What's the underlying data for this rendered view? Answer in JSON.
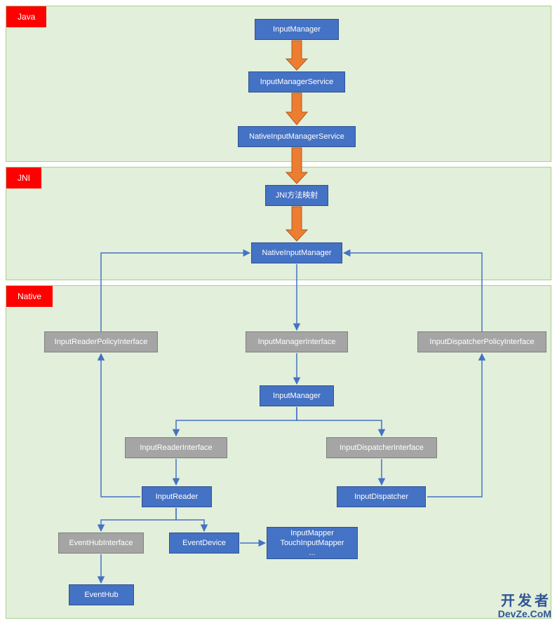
{
  "sections": {
    "java": {
      "label": "Java"
    },
    "jni": {
      "label": "JNI"
    },
    "native": {
      "label": "Native"
    }
  },
  "boxes": {
    "input_manager_top": "InputManager",
    "input_manager_service": "InputManagerService",
    "native_input_manager_service": "NativeInputManagerService",
    "jni_method_map": "JNI方法映射",
    "native_input_manager": "NativeInputManager",
    "input_reader_policy_interface": "InputReaderPolicyInterface",
    "input_manager_interface": "InputManagerInterface",
    "input_dispatcher_policy_interface": "InputDispatcherPolicyInterface",
    "input_manager": "InputManager",
    "input_reader_interface": "InputReaderInterface",
    "input_dispatcher_interface": "InputDispatcherInterface",
    "input_reader": "InputReader",
    "input_dispatcher": "InputDispatcher",
    "event_hub_interface": "EventHubInterface",
    "event_device": "EventDevice",
    "input_mapper": "InputMapper\nTouchInputMapper\n...",
    "event_hub": "EventHub"
  },
  "watermark": {
    "cn": "开发者",
    "en": "DevZe.CoM"
  },
  "chart_data": {
    "type": "diagram",
    "title": "",
    "layers": [
      {
        "name": "Java",
        "nodes": [
          "InputManager",
          "InputManagerService",
          "NativeInputManagerService"
        ]
      },
      {
        "name": "JNI",
        "nodes": [
          "JNI方法映射",
          "NativeInputManager"
        ]
      },
      {
        "name": "Native",
        "nodes": [
          "InputReaderPolicyInterface",
          "InputManagerInterface",
          "InputDispatcherPolicyInterface",
          "InputManager",
          "InputReaderInterface",
          "InputDispatcherInterface",
          "InputReader",
          "InputDispatcher",
          "EventHubInterface",
          "EventDevice",
          "InputMapper/TouchInputMapper/...",
          "EventHub"
        ]
      }
    ],
    "edges": [
      {
        "from": "InputManager(Java)",
        "to": "InputManagerService",
        "style": "thick-orange"
      },
      {
        "from": "InputManagerService",
        "to": "NativeInputManagerService",
        "style": "thick-orange"
      },
      {
        "from": "NativeInputManagerService",
        "to": "JNI方法映射",
        "style": "thick-orange"
      },
      {
        "from": "JNI方法映射",
        "to": "NativeInputManager",
        "style": "thick-orange"
      },
      {
        "from": "NativeInputManager",
        "to": "InputReaderPolicyInterface",
        "style": "blue-arrow",
        "reverse": true
      },
      {
        "from": "NativeInputManager",
        "to": "InputDispatcherPolicyInterface",
        "style": "blue-arrow",
        "reverse": true
      },
      {
        "from": "NativeInputManager",
        "to": "InputManagerInterface",
        "style": "blue-arrow"
      },
      {
        "from": "InputManagerInterface",
        "to": "InputManager(Native)",
        "style": "blue-arrow"
      },
      {
        "from": "InputManager(Native)",
        "to": "InputReaderInterface",
        "style": "blue-arrow"
      },
      {
        "from": "InputManager(Native)",
        "to": "InputDispatcherInterface",
        "style": "blue-arrow"
      },
      {
        "from": "InputReaderInterface",
        "to": "InputReader",
        "style": "blue-arrow"
      },
      {
        "from": "InputDispatcherInterface",
        "to": "InputDispatcher",
        "style": "blue-arrow"
      },
      {
        "from": "InputReader",
        "to": "InputReaderPolicyInterface",
        "style": "blue-arrow"
      },
      {
        "from": "InputDispatcher",
        "to": "InputDispatcherPolicyInterface",
        "style": "blue-arrow"
      },
      {
        "from": "InputReader",
        "to": "EventHubInterface",
        "style": "blue-arrow"
      },
      {
        "from": "InputReader",
        "to": "EventDevice",
        "style": "blue-arrow"
      },
      {
        "from": "EventDevice",
        "to": "InputMapper/TouchInputMapper/...",
        "style": "blue-arrow"
      },
      {
        "from": "EventHubInterface",
        "to": "EventHub",
        "style": "blue-arrow"
      }
    ]
  }
}
